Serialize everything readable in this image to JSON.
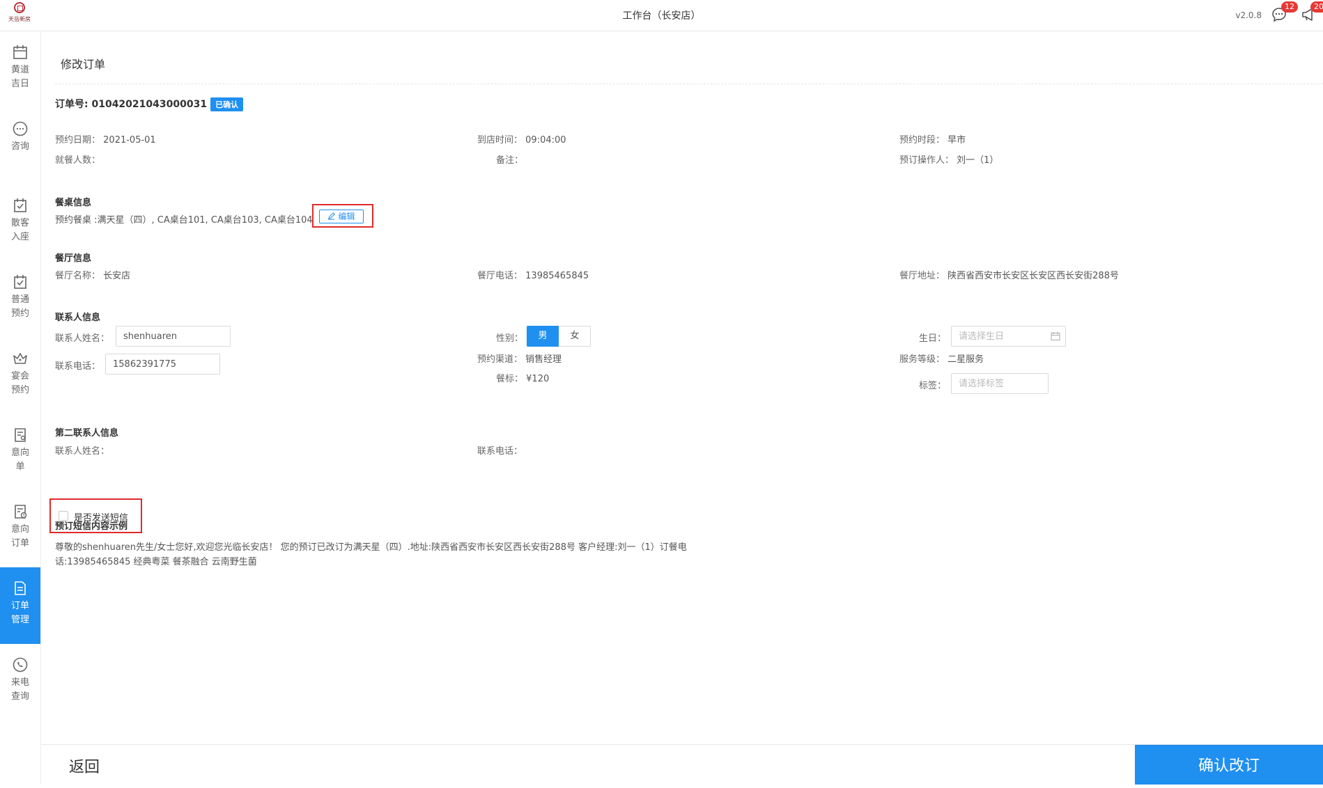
{
  "app": {
    "logo_text": "天岳新房",
    "title": "工作台（长安店）",
    "version": "v2.0.8",
    "messages_badge": "12",
    "notices_badge": "20"
  },
  "sidebar": {
    "items": [
      {
        "label": "黄道\n吉日",
        "icon": "calendar-icon"
      },
      {
        "label": "咨询",
        "icon": "chat-icon"
      },
      {
        "label": "散客\n入座",
        "icon": "checklist-icon"
      },
      {
        "label": "普通\n预约",
        "icon": "checklist-icon"
      },
      {
        "label": "宴会\n预约",
        "icon": "crown-icon"
      },
      {
        "label": "意向\n单",
        "icon": "document-user-icon"
      },
      {
        "label": "意向\n订单",
        "icon": "document-clock-icon"
      },
      {
        "label": "订单\n管理",
        "icon": "document-icon",
        "active": true
      },
      {
        "label": "来电\n查询",
        "icon": "phone-icon"
      }
    ]
  },
  "page": {
    "title": "修改订单"
  },
  "order": {
    "number_label": "订单号: 01042021043000031",
    "status": "已确认",
    "date_label": "预约日期：",
    "date_value": "2021-05-01",
    "arrival_label": "到店时间：",
    "arrival_value": "09:04:00",
    "period_label": "预约时段：",
    "period_value": "早市",
    "guests_label": "就餐人数：",
    "guests_value": "",
    "remark_label": "备注：",
    "remark_value": "",
    "operator_label": "预订操作人：",
    "operator_value": "刘一（1）"
  },
  "table_info": {
    "title": "餐桌信息",
    "tables_text": "预约餐桌 :满天星（四）, CA桌台101, CA桌台103, CA桌台104",
    "edit_label": "编辑"
  },
  "restaurant": {
    "title": "餐厅信息",
    "name_label": "餐厅名称：",
    "name_value": "长安店",
    "phone_label": "餐厅电话：",
    "phone_value": "13985465845",
    "address_label": "餐厅地址：",
    "address_value": "陕西省西安市长安区长安区西长安街288号"
  },
  "contact": {
    "title": "联系人信息",
    "name_label": "联系人姓名：",
    "name_value": "shenhuaren",
    "phone_label": "联系电话：",
    "phone_value": "15862391775",
    "gender_label": "性别：",
    "gender_options": [
      "男",
      "女"
    ],
    "gender_selected": "男",
    "channel_label": "预约渠道：",
    "channel_value": "销售经理",
    "standard_label": "餐标：",
    "standard_value": "¥120",
    "birthday_label": "生日：",
    "birthday_placeholder": "请选择生日",
    "level_label": "服务等级：",
    "level_value": "二星服务",
    "tag_label": "标签：",
    "tag_placeholder": "请选择标签"
  },
  "second_contact": {
    "title": "第二联系人信息",
    "name_label": "联系人姓名：",
    "phone_label": "联系电话："
  },
  "sms": {
    "checkbox_label": "是否发送短信",
    "checked": false,
    "example_title": "预订短信内容示例",
    "example_text": "尊敬的shenhuaren先生/女士您好,欢迎您光临长安店！ 您的预订已改订为满天星（四）.地址:陕西省西安市长安区西长安街288号 客户经理:刘一（1）订餐电话:13985465845 经典粤菜 餐茶融合 云南野生菌"
  },
  "footer": {
    "back_label": "返回",
    "confirm_label": "确认改订"
  },
  "colors": {
    "primary": "#1f8ff0",
    "highlight": "#e02a2a",
    "badge": "#e53935"
  }
}
